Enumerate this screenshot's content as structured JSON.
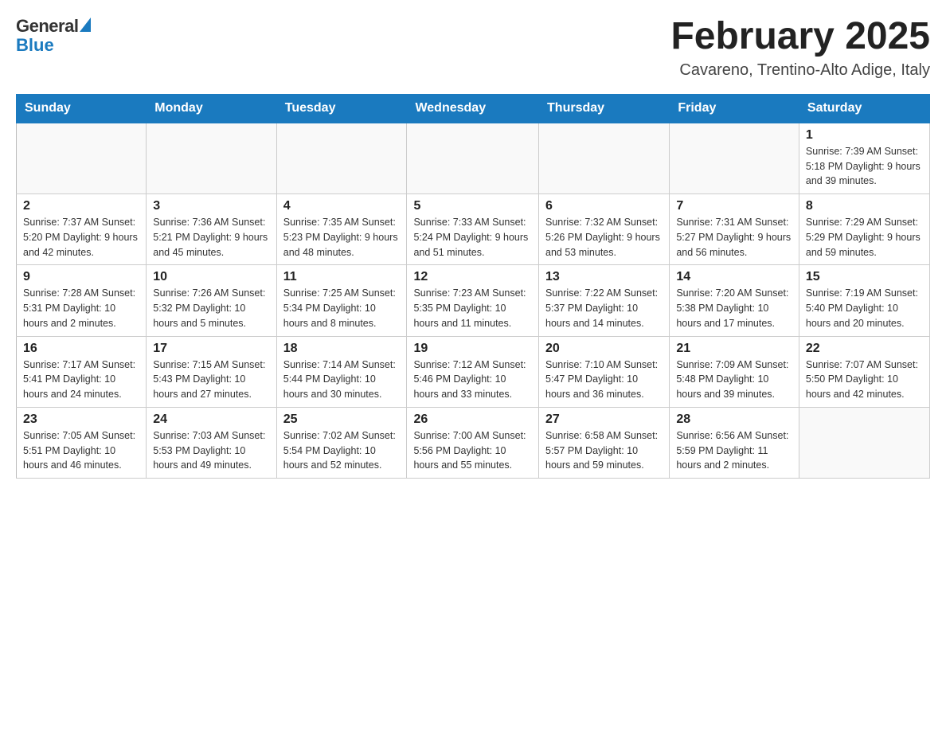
{
  "logo": {
    "general": "General",
    "blue": "Blue"
  },
  "title": "February 2025",
  "subtitle": "Cavareno, Trentino-Alto Adige, Italy",
  "days_of_week": [
    "Sunday",
    "Monday",
    "Tuesday",
    "Wednesday",
    "Thursday",
    "Friday",
    "Saturday"
  ],
  "weeks": [
    [
      {
        "day": "",
        "info": ""
      },
      {
        "day": "",
        "info": ""
      },
      {
        "day": "",
        "info": ""
      },
      {
        "day": "",
        "info": ""
      },
      {
        "day": "",
        "info": ""
      },
      {
        "day": "",
        "info": ""
      },
      {
        "day": "1",
        "info": "Sunrise: 7:39 AM\nSunset: 5:18 PM\nDaylight: 9 hours and 39 minutes."
      }
    ],
    [
      {
        "day": "2",
        "info": "Sunrise: 7:37 AM\nSunset: 5:20 PM\nDaylight: 9 hours and 42 minutes."
      },
      {
        "day": "3",
        "info": "Sunrise: 7:36 AM\nSunset: 5:21 PM\nDaylight: 9 hours and 45 minutes."
      },
      {
        "day": "4",
        "info": "Sunrise: 7:35 AM\nSunset: 5:23 PM\nDaylight: 9 hours and 48 minutes."
      },
      {
        "day": "5",
        "info": "Sunrise: 7:33 AM\nSunset: 5:24 PM\nDaylight: 9 hours and 51 minutes."
      },
      {
        "day": "6",
        "info": "Sunrise: 7:32 AM\nSunset: 5:26 PM\nDaylight: 9 hours and 53 minutes."
      },
      {
        "day": "7",
        "info": "Sunrise: 7:31 AM\nSunset: 5:27 PM\nDaylight: 9 hours and 56 minutes."
      },
      {
        "day": "8",
        "info": "Sunrise: 7:29 AM\nSunset: 5:29 PM\nDaylight: 9 hours and 59 minutes."
      }
    ],
    [
      {
        "day": "9",
        "info": "Sunrise: 7:28 AM\nSunset: 5:31 PM\nDaylight: 10 hours and 2 minutes."
      },
      {
        "day": "10",
        "info": "Sunrise: 7:26 AM\nSunset: 5:32 PM\nDaylight: 10 hours and 5 minutes."
      },
      {
        "day": "11",
        "info": "Sunrise: 7:25 AM\nSunset: 5:34 PM\nDaylight: 10 hours and 8 minutes."
      },
      {
        "day": "12",
        "info": "Sunrise: 7:23 AM\nSunset: 5:35 PM\nDaylight: 10 hours and 11 minutes."
      },
      {
        "day": "13",
        "info": "Sunrise: 7:22 AM\nSunset: 5:37 PM\nDaylight: 10 hours and 14 minutes."
      },
      {
        "day": "14",
        "info": "Sunrise: 7:20 AM\nSunset: 5:38 PM\nDaylight: 10 hours and 17 minutes."
      },
      {
        "day": "15",
        "info": "Sunrise: 7:19 AM\nSunset: 5:40 PM\nDaylight: 10 hours and 20 minutes."
      }
    ],
    [
      {
        "day": "16",
        "info": "Sunrise: 7:17 AM\nSunset: 5:41 PM\nDaylight: 10 hours and 24 minutes."
      },
      {
        "day": "17",
        "info": "Sunrise: 7:15 AM\nSunset: 5:43 PM\nDaylight: 10 hours and 27 minutes."
      },
      {
        "day": "18",
        "info": "Sunrise: 7:14 AM\nSunset: 5:44 PM\nDaylight: 10 hours and 30 minutes."
      },
      {
        "day": "19",
        "info": "Sunrise: 7:12 AM\nSunset: 5:46 PM\nDaylight: 10 hours and 33 minutes."
      },
      {
        "day": "20",
        "info": "Sunrise: 7:10 AM\nSunset: 5:47 PM\nDaylight: 10 hours and 36 minutes."
      },
      {
        "day": "21",
        "info": "Sunrise: 7:09 AM\nSunset: 5:48 PM\nDaylight: 10 hours and 39 minutes."
      },
      {
        "day": "22",
        "info": "Sunrise: 7:07 AM\nSunset: 5:50 PM\nDaylight: 10 hours and 42 minutes."
      }
    ],
    [
      {
        "day": "23",
        "info": "Sunrise: 7:05 AM\nSunset: 5:51 PM\nDaylight: 10 hours and 46 minutes."
      },
      {
        "day": "24",
        "info": "Sunrise: 7:03 AM\nSunset: 5:53 PM\nDaylight: 10 hours and 49 minutes."
      },
      {
        "day": "25",
        "info": "Sunrise: 7:02 AM\nSunset: 5:54 PM\nDaylight: 10 hours and 52 minutes."
      },
      {
        "day": "26",
        "info": "Sunrise: 7:00 AM\nSunset: 5:56 PM\nDaylight: 10 hours and 55 minutes."
      },
      {
        "day": "27",
        "info": "Sunrise: 6:58 AM\nSunset: 5:57 PM\nDaylight: 10 hours and 59 minutes."
      },
      {
        "day": "28",
        "info": "Sunrise: 6:56 AM\nSunset: 5:59 PM\nDaylight: 11 hours and 2 minutes."
      },
      {
        "day": "",
        "info": ""
      }
    ]
  ]
}
